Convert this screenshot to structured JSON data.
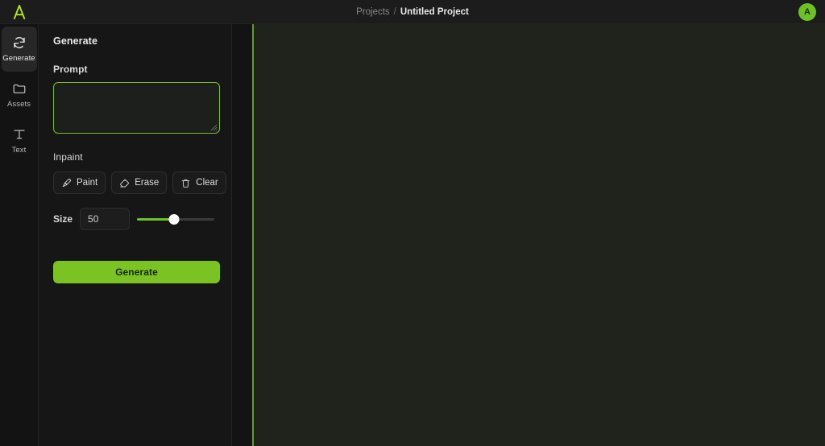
{
  "topbar": {
    "logo_icon": "letter-a-logo",
    "breadcrumb": {
      "root": "Projects",
      "separator": "/",
      "current": "Untitled Project"
    },
    "avatar_initial": "A",
    "avatar_color": "#6cc125"
  },
  "rail": {
    "items": [
      {
        "label": "Generate",
        "icon": "refresh-cycle-icon",
        "active": true
      },
      {
        "label": "Assets",
        "icon": "folder-icon",
        "active": false
      },
      {
        "label": "Text",
        "icon": "text-t-icon",
        "active": false
      }
    ]
  },
  "panel": {
    "title": "Generate",
    "prompt": {
      "label": "Prompt",
      "value": "",
      "placeholder": "",
      "focused": true,
      "border_color": "#7cbb2e"
    },
    "inpaint": {
      "label": "Inpaint",
      "tools": [
        {
          "label": "Paint",
          "icon": "paintbrush-icon"
        },
        {
          "label": "Erase",
          "icon": "eraser-icon"
        },
        {
          "label": "Clear",
          "icon": "trash-icon"
        }
      ],
      "size": {
        "label": "Size",
        "value": "50",
        "slider_percent": 48,
        "slider_fill_color": "#6fc22a"
      }
    },
    "generate_button": {
      "label": "Generate",
      "color": "#7ac322"
    }
  },
  "canvas": {
    "background_color": "#1f231b",
    "edge_color": "#5f9e1e"
  }
}
